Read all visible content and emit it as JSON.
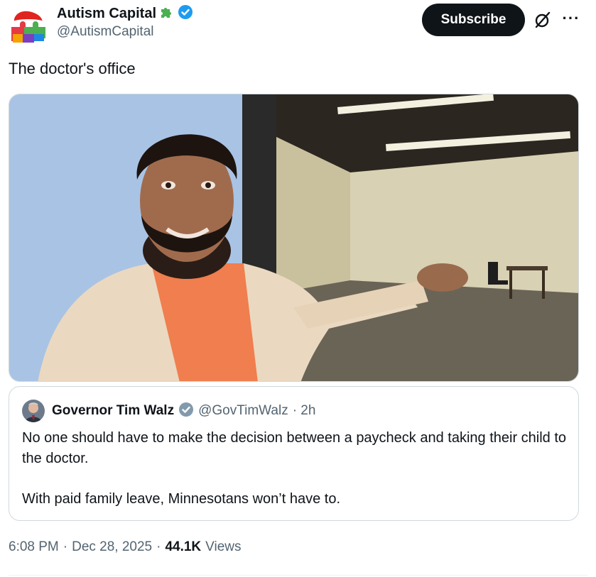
{
  "author": {
    "display_name": "Autism Capital",
    "handle": "@AutismCapital",
    "emoji_icon": "puzzle-piece-icon",
    "verified_icon": "verified-badge-icon"
  },
  "actions": {
    "subscribe_label": "Subscribe",
    "grok_icon": "grok-icon",
    "more_label": "···"
  },
  "tweet": {
    "text": "The doctor's office"
  },
  "media": {
    "kind": "photo",
    "description_icon": "video-still"
  },
  "quote": {
    "display_name": "Governor Tim Walz",
    "handle": "@GovTimWalz",
    "time": "· 2h",
    "line1": "No one should have to make the decision between a paycheck and taking their child to the doctor.",
    "line2": "With paid family leave, Minnesotans won’t have to."
  },
  "meta": {
    "time": "6:08 PM",
    "sep1": "·",
    "date": "Dec 28, 2025",
    "sep2": "·",
    "views_count": "44.1K",
    "views_label": "Views"
  },
  "colors": {
    "text": "#0f1419",
    "secondary": "#536471",
    "verified": "#1d9bf0",
    "border": "#cfd9de"
  }
}
